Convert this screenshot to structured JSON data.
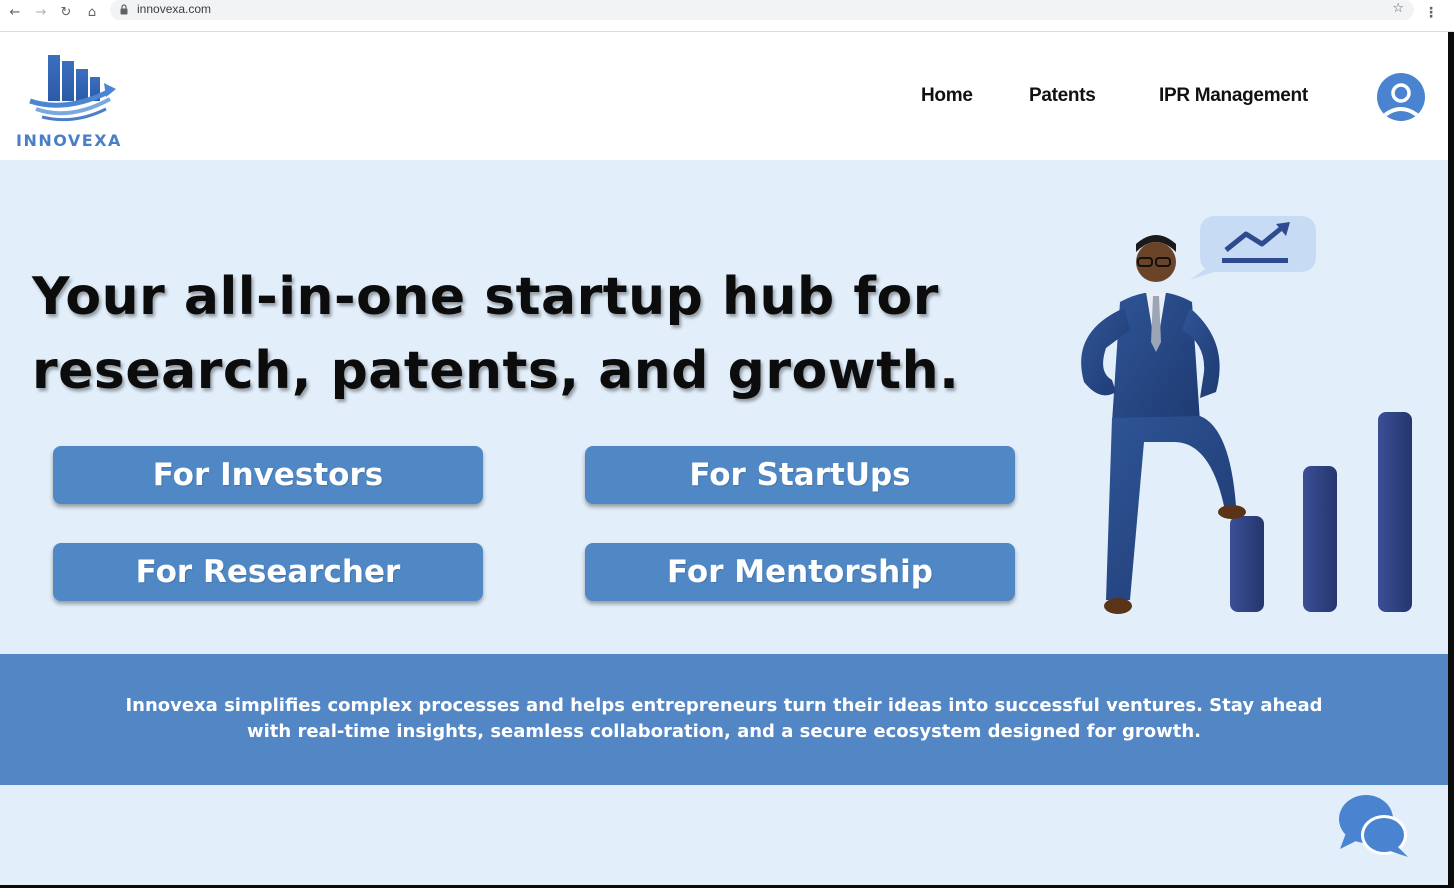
{
  "browser": {
    "url": "innovexa.com",
    "back_icon": "arrow-left-icon",
    "forward_icon": "arrow-right-icon",
    "reload_icon": "reload-icon",
    "home_icon": "home-icon",
    "lock_icon": "lock-icon",
    "bookmark_icon": "star-icon",
    "menu_icon": "kebab-menu-icon"
  },
  "header": {
    "logo_text": "INNOVEXA",
    "nav": [
      {
        "label": "Home"
      },
      {
        "label": "Patents"
      },
      {
        "label": "IPR Management"
      }
    ],
    "avatar_icon": "user-avatar-icon"
  },
  "hero": {
    "title_line1": "Your all-in-one startup hub for",
    "title_line2": "research, patents, and growth.",
    "buttons": [
      {
        "label": "For Investors"
      },
      {
        "label": "For StartUps"
      },
      {
        "label": "For Researcher"
      },
      {
        "label": "For Mentorship"
      }
    ]
  },
  "info": {
    "line1": "Innovexa simplifies complex processes and helps entrepreneurs turn their ideas into successful ventures. Stay ahead",
    "line2": "with real-time insights, seamless collaboration, and a secure ecosystem designed for growth."
  },
  "chat": {
    "icon": "chat-bubbles-icon"
  },
  "colors": {
    "accent": "#5088c6",
    "hero_bg": "#e2effb",
    "band_bg": "#5386c4",
    "logo_blue": "#4a7fc8"
  }
}
